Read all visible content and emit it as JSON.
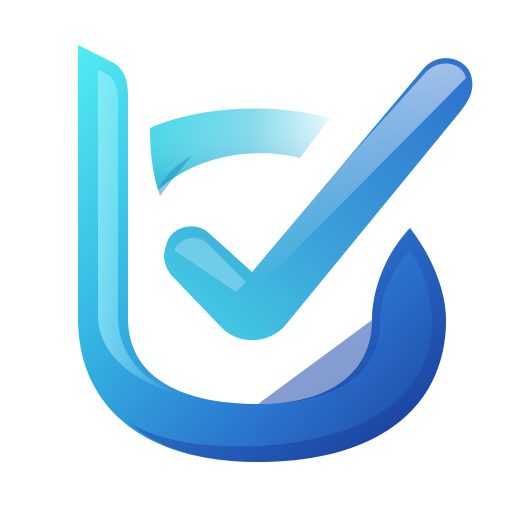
{
  "logo": {
    "name": "checkmark-u-logo",
    "icon": "check-shield-icon",
    "colors": {
      "cyan": "#4ee6f0",
      "light_blue": "#6fd6ec",
      "mid_blue": "#3b8ed8",
      "deep_blue": "#2350b8",
      "navy": "#1b3f9e",
      "highlight": "#e8fbff",
      "background": "#ffffff"
    }
  }
}
